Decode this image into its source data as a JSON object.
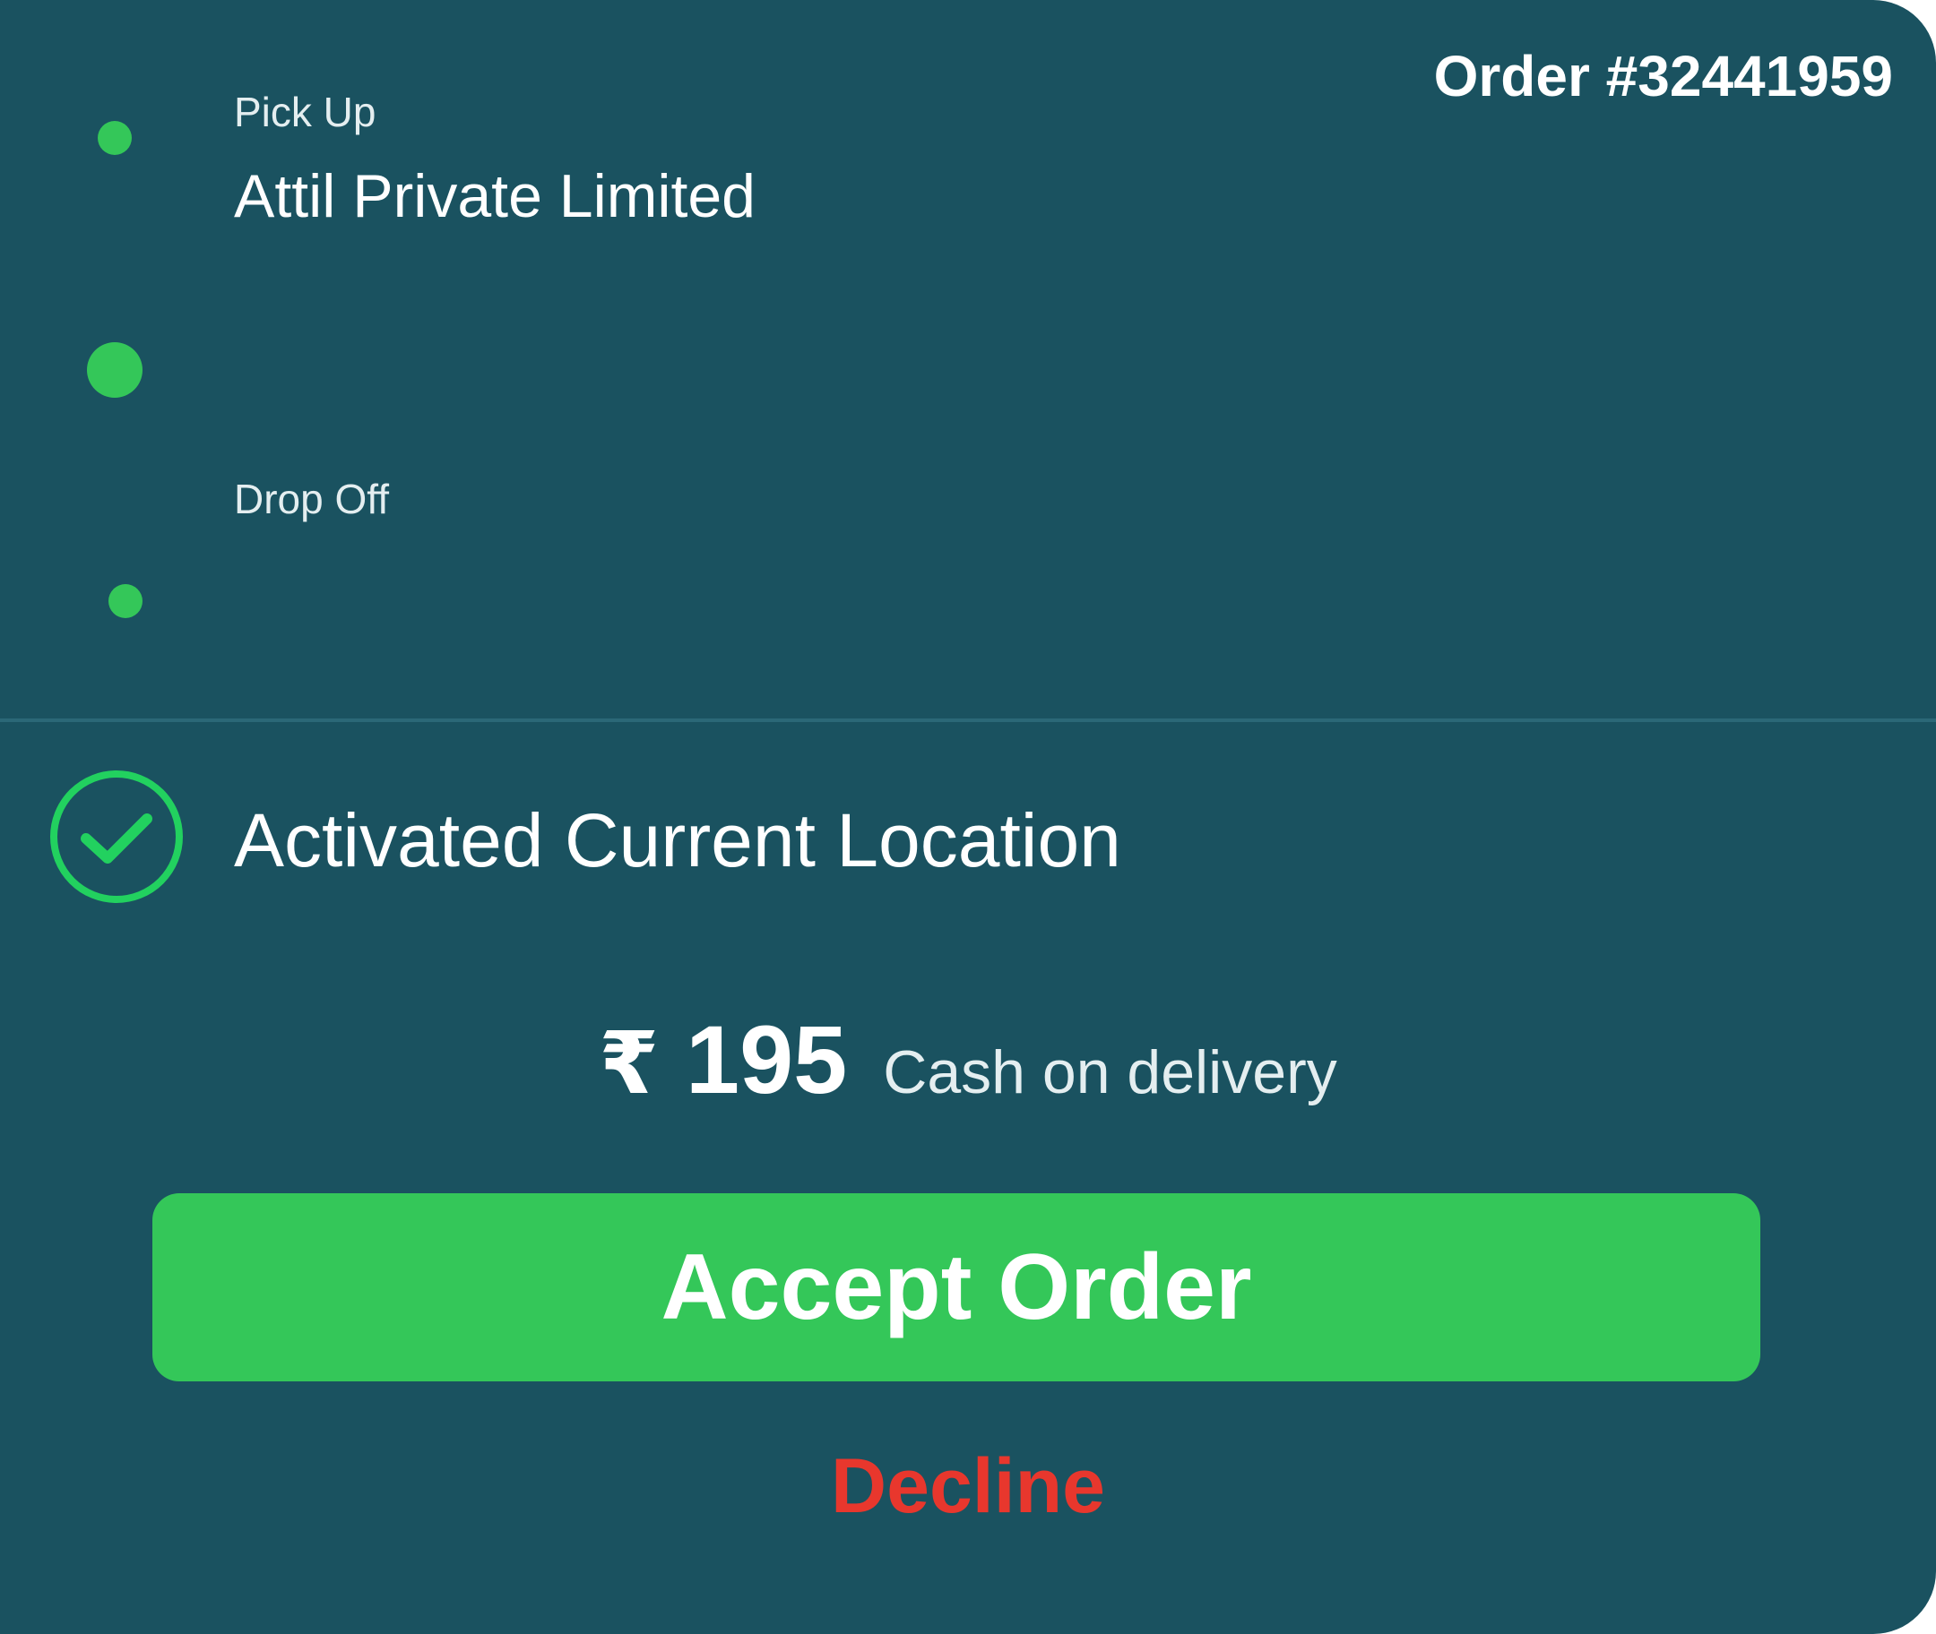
{
  "order": {
    "number_label": "Order #32441959"
  },
  "pickup": {
    "label": "Pick Up",
    "name": "Attil Private Limited"
  },
  "dropoff": {
    "label": "Drop Off",
    "name": ""
  },
  "location_status": {
    "text": "Activated Current Location",
    "icon": "check-circle-icon"
  },
  "payment": {
    "currency": "₹",
    "amount": "195",
    "method": "Cash on delivery"
  },
  "actions": {
    "accept_label": "Accept Order",
    "decline_label": "Decline"
  },
  "colors": {
    "background": "#1a5260",
    "accent_green": "#34c759",
    "decline_red": "#e8372d",
    "text": "#ffffff"
  }
}
